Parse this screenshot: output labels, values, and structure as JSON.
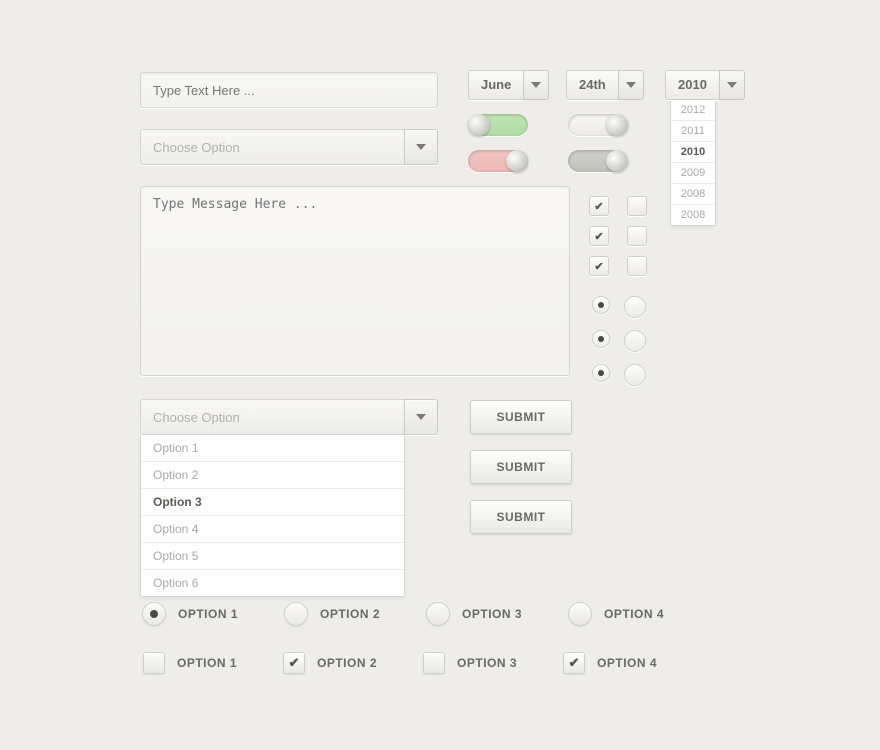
{
  "text_input": {
    "placeholder": "Type Text Here ..."
  },
  "select1": {
    "placeholder": "Choose Option"
  },
  "textarea": {
    "placeholder": "Type Message Here ..."
  },
  "select2": {
    "placeholder": "Choose Option",
    "options": [
      "Option 1",
      "Option 2",
      "Option 3",
      "Option 4",
      "Option 5",
      "Option 6"
    ],
    "selected_index": 2
  },
  "date": {
    "month": "June",
    "day": "24th",
    "year": "2010",
    "year_options": [
      "2012",
      "2011",
      "2010",
      "2009",
      "2008",
      "2008"
    ],
    "year_selected_index": 2
  },
  "toggles": {
    "green_on": true,
    "white_off": false,
    "pink_off": false,
    "grey_off": false
  },
  "small_checks": [
    {
      "a": true,
      "b": false
    },
    {
      "a": true,
      "b": false
    },
    {
      "a": true,
      "b": false
    }
  ],
  "small_radios": [
    {
      "a": true,
      "b": false
    },
    {
      "a": true,
      "b": false
    },
    {
      "a": true,
      "b": false
    }
  ],
  "buttons": {
    "submit1": "SUBMIT",
    "submit2": "SUBMIT",
    "submit3": "SUBMIT"
  },
  "radio_row": [
    {
      "label": "OPTION 1",
      "selected": true
    },
    {
      "label": "OPTION 2",
      "selected": false
    },
    {
      "label": "OPTION 3",
      "selected": false
    },
    {
      "label": "OPTION 4",
      "selected": false
    }
  ],
  "check_row": [
    {
      "label": "OPTION 1",
      "checked": false
    },
    {
      "label": "OPTION 2",
      "checked": true
    },
    {
      "label": "OPTION 3",
      "checked": false
    },
    {
      "label": "OPTION 4",
      "checked": true
    }
  ]
}
